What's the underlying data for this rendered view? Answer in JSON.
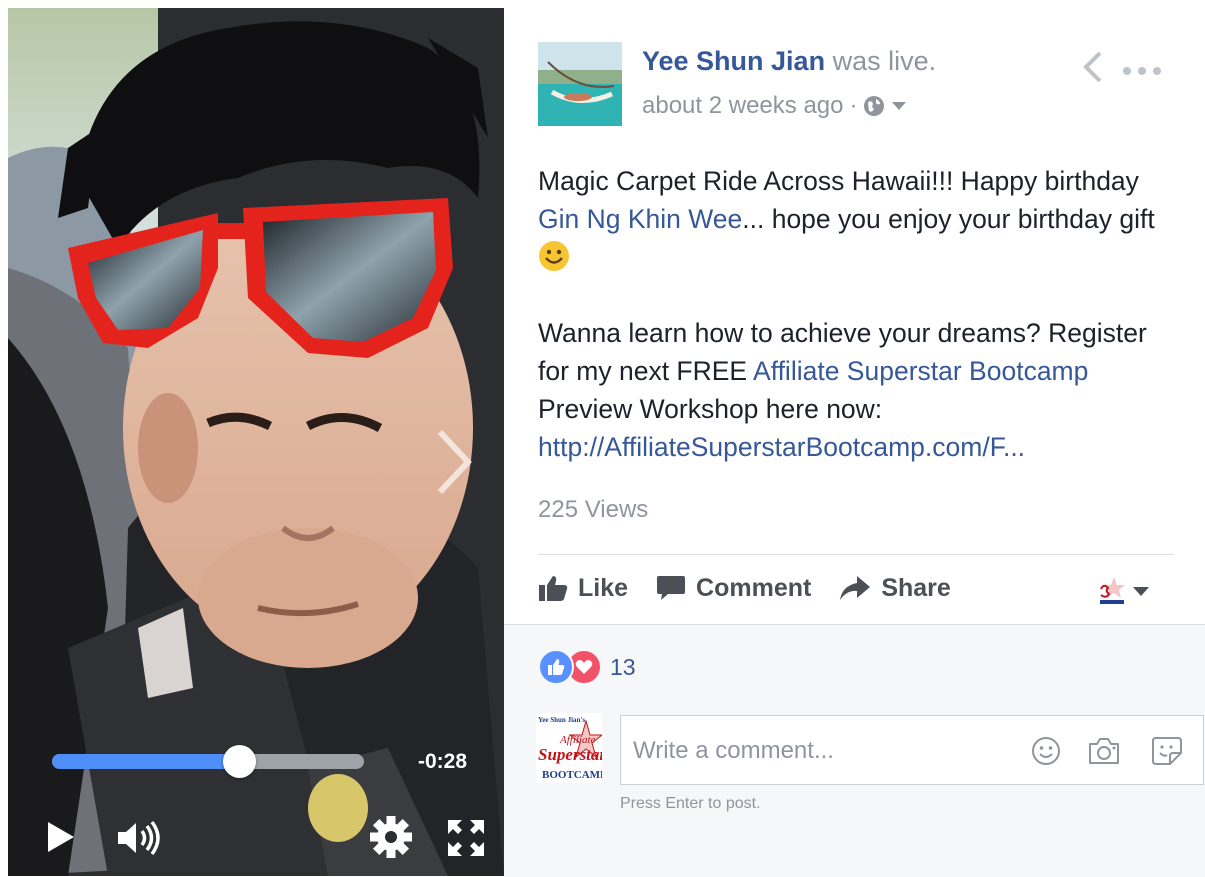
{
  "video": {
    "progress": 0.6,
    "time_remaining": "-0:28",
    "controls": {
      "play": "play-icon",
      "volume": "volume-icon",
      "settings": "gear-icon",
      "fullscreen": "fullscreen-icon",
      "next": "chevron-right-icon"
    }
  },
  "post": {
    "author": "Yee Shun Jian",
    "action": "was live.",
    "time": "about 2 weeks ago",
    "privacy_icon": "globe-icon",
    "text": {
      "p1_a": "Magic Carpet Ride Across Hawaii!!! Happy birthday ",
      "p1_link": "Gin Ng Khin Wee",
      "p1_b": "... hope you enjoy your birthday gift ",
      "p2_a": "Wanna learn how to achieve your dreams? Register for my next FREE ",
      "p2_link": "Affiliate Superstar Bootcamp",
      "p2_b": " Preview Workshop here now: ",
      "p2_url": "http://AffiliateSuperstarBootcamp.com/F..."
    },
    "views": "225 Views"
  },
  "actions": {
    "like": "Like",
    "comment": "Comment",
    "share": "Share"
  },
  "reactions": {
    "count": "13"
  },
  "comment": {
    "placeholder": "Write a comment...",
    "hint": "Press Enter to post.",
    "page_logo_text": {
      "line1": "Yee Shun Jian's",
      "line2": "Affiliate",
      "line3": "Superstar",
      "line4": "BOOTCAMP"
    }
  },
  "colors": {
    "link": "#365899",
    "progress": "#4f8ef7",
    "like": "#5890ff",
    "love": "#f25268"
  }
}
